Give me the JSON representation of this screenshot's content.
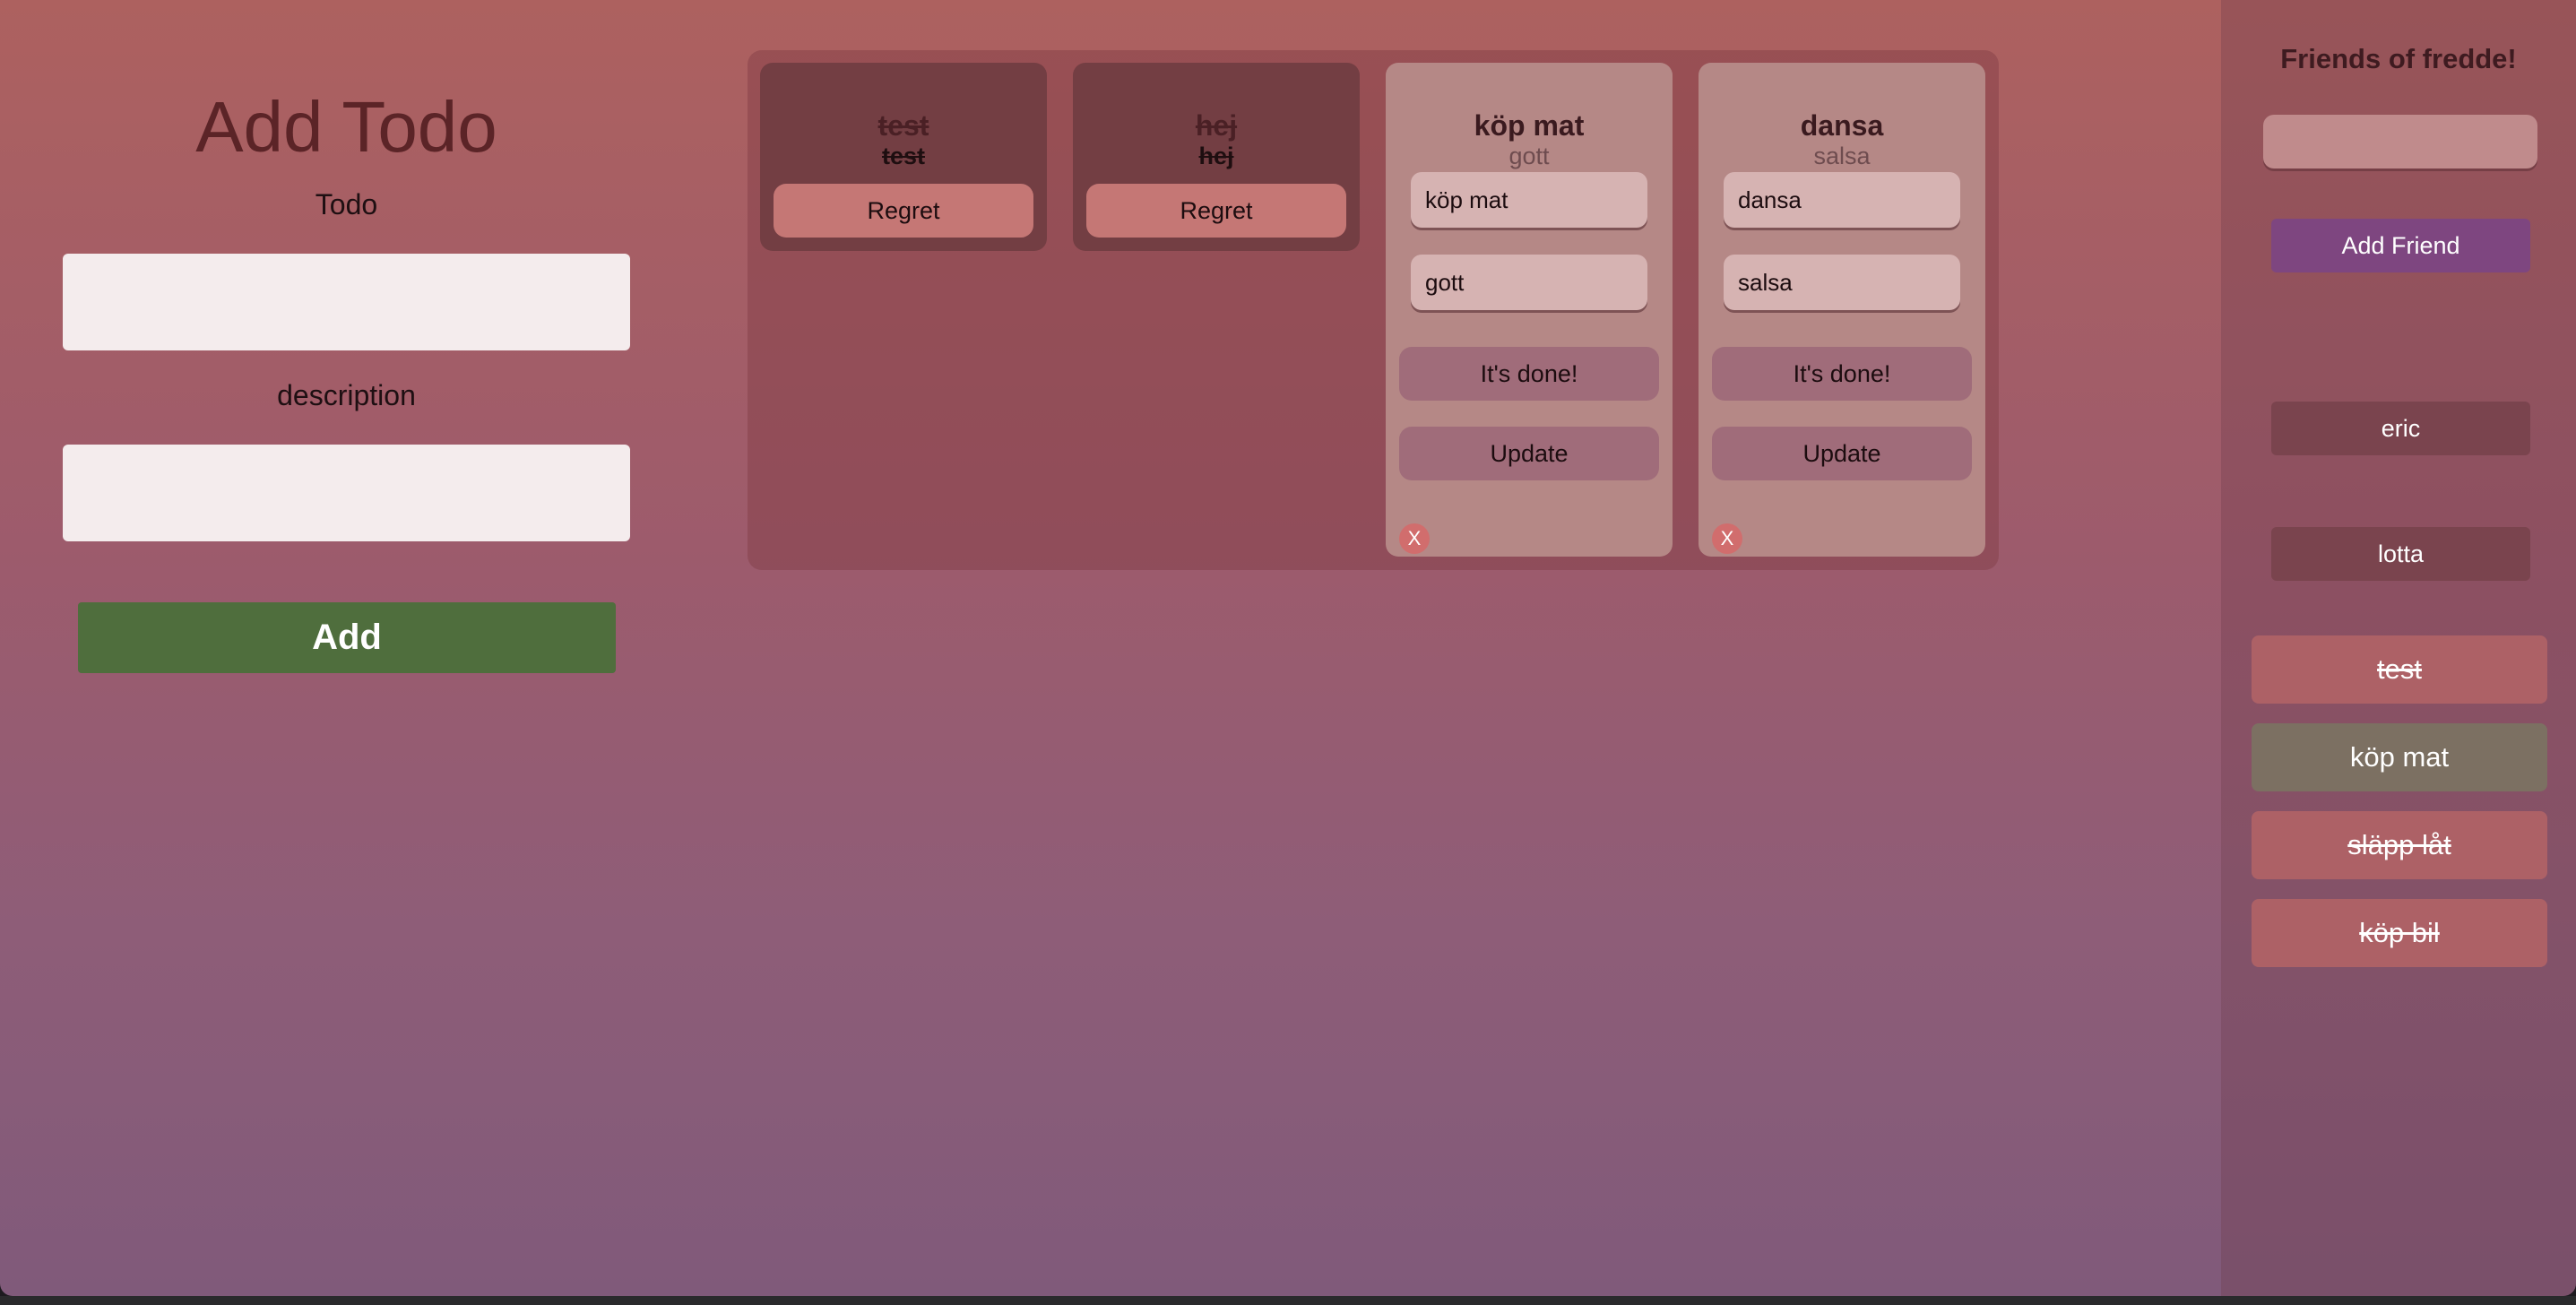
{
  "add_todo": {
    "title": "Add Todo",
    "todo_label": "Todo",
    "todo_value": "",
    "description_label": "description",
    "description_value": "",
    "add_button_label": "Add"
  },
  "board": {
    "done_cards": [
      {
        "title": "test",
        "description": "test",
        "regret_label": "Regret"
      },
      {
        "title": "hej",
        "description": "hej",
        "regret_label": "Regret"
      }
    ],
    "open_cards": [
      {
        "title": "köp mat",
        "description": "gott",
        "edit_title_value": "köp mat",
        "edit_description_value": "gott",
        "done_label": "It's done!",
        "update_label": "Update",
        "delete_label": "X"
      },
      {
        "title": "dansa",
        "description": "salsa",
        "edit_title_value": "dansa",
        "edit_description_value": "salsa",
        "done_label": "It's done!",
        "update_label": "Update",
        "delete_label": "X"
      }
    ]
  },
  "friends": {
    "title": "Friends of fredde!",
    "input_value": "",
    "add_friend_label": "Add Friend",
    "list": [
      "eric",
      "lotta"
    ],
    "todos": [
      {
        "label": "test",
        "done": true
      },
      {
        "label": "köp mat",
        "done": false
      },
      {
        "label": "släpp låt",
        "done": true
      },
      {
        "label": "köp bil",
        "done": true
      }
    ]
  },
  "colors": {
    "add_button": "#4f6e3d",
    "add_friend_button": "#7e4680",
    "open_friend_todo": "#7c7062",
    "done_friend_todo": "#ad6166"
  }
}
